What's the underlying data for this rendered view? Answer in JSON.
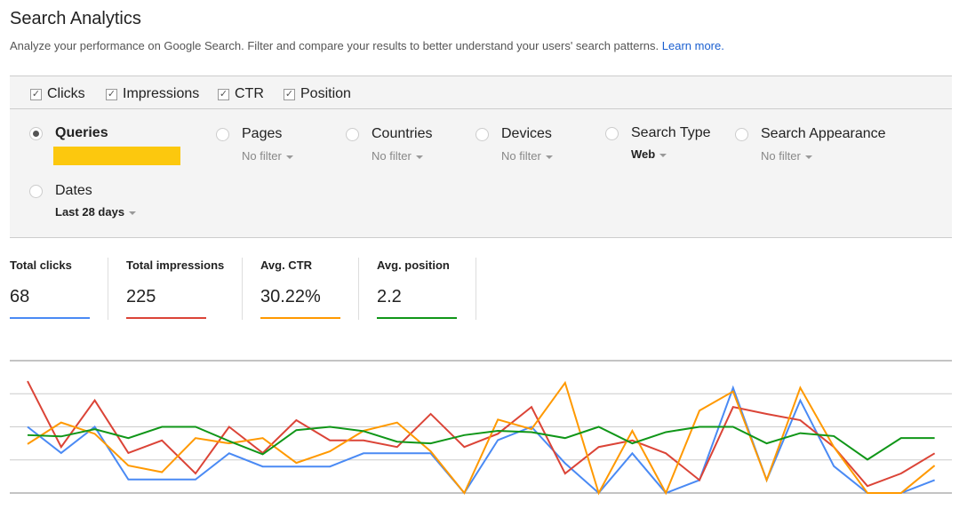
{
  "header": {
    "title": "Search Analytics",
    "subtitle": "Analyze your performance on Google Search. Filter and compare your results to better understand your users' search patterns.",
    "learn_more": "Learn more."
  },
  "metric_toggles": [
    {
      "label": "Clicks",
      "checked": true
    },
    {
      "label": "Impressions",
      "checked": true
    },
    {
      "label": "CTR",
      "checked": true
    },
    {
      "label": "Position",
      "checked": true
    }
  ],
  "dimensions": [
    {
      "label": "Queries",
      "selected": true,
      "filter": ""
    },
    {
      "label": "Pages",
      "selected": false,
      "filter": "No filter"
    },
    {
      "label": "Countries",
      "selected": false,
      "filter": "No filter"
    },
    {
      "label": "Devices",
      "selected": false,
      "filter": "No filter"
    },
    {
      "label": "Search Type",
      "selected": false,
      "filter": "Web"
    },
    {
      "label": "Search Appearance",
      "selected": false,
      "filter": "No filter"
    },
    {
      "label": "Dates",
      "selected": false,
      "filter": "Last 28 days"
    }
  ],
  "totals": [
    {
      "label": "Total clicks",
      "value": "68",
      "color": "#4a8af4"
    },
    {
      "label": "Total impressions",
      "value": "225",
      "color": "#db4437"
    },
    {
      "label": "Avg. CTR",
      "value": "30.22%",
      "color": "#ff9900"
    },
    {
      "label": "Avg. position",
      "value": "2.2",
      "color": "#109618"
    }
  ],
  "chart_data": {
    "type": "line",
    "title": "",
    "xlabel": "",
    "ylabel": "",
    "ylim": [
      0,
      4
    ],
    "grid": true,
    "x": [
      1,
      2,
      3,
      4,
      5,
      6,
      7,
      8,
      9,
      10,
      11,
      12,
      13,
      14,
      15,
      16,
      17,
      18,
      19,
      20,
      21,
      22,
      23,
      24,
      25,
      26,
      27,
      28
    ],
    "series": [
      {
        "name": "Clicks",
        "color": "#4a8af4",
        "values": [
          2.0,
          1.21,
          2.0,
          0.41,
          0.41,
          0.41,
          1.2,
          0.8,
          0.8,
          0.8,
          1.2,
          1.2,
          1.2,
          0,
          1.6,
          2.0,
          0.9,
          0,
          1.2,
          0,
          0.39,
          3.18,
          0.39,
          2.8,
          0.81,
          0,
          0,
          0.39
        ]
      },
      {
        "name": "Impressions",
        "color": "#db4437",
        "values": [
          3.38,
          1.39,
          2.8,
          1.21,
          1.59,
          0.59,
          2.0,
          1.21,
          2.2,
          1.59,
          1.59,
          1.39,
          2.39,
          1.39,
          1.79,
          2.6,
          0.59,
          1.39,
          1.59,
          1.2,
          0.39,
          2.6,
          2.39,
          2.2,
          1.39,
          0.21,
          0.59,
          1.2
        ]
      },
      {
        "name": "CTR",
        "color": "#ff9900",
        "values": [
          1.48,
          2.13,
          1.79,
          0.83,
          0.63,
          1.66,
          1.5,
          1.66,
          0.91,
          1.26,
          1.88,
          2.13,
          1.26,
          0,
          2.22,
          1.93,
          3.33,
          0,
          1.88,
          0,
          2.49,
          3.07,
          0.39,
          3.18,
          1.39,
          0,
          0,
          0.83
        ]
      },
      {
        "name": "Position",
        "color": "#109618",
        "values": [
          1.75,
          1.71,
          1.93,
          1.66,
          2.0,
          2.0,
          1.57,
          1.17,
          1.9,
          2.0,
          1.87,
          1.55,
          1.5,
          1.75,
          1.88,
          1.84,
          1.66,
          2.0,
          1.5,
          1.84,
          2.0,
          2.0,
          1.5,
          1.81,
          1.72,
          1.01,
          1.66,
          1.66
        ]
      }
    ]
  }
}
